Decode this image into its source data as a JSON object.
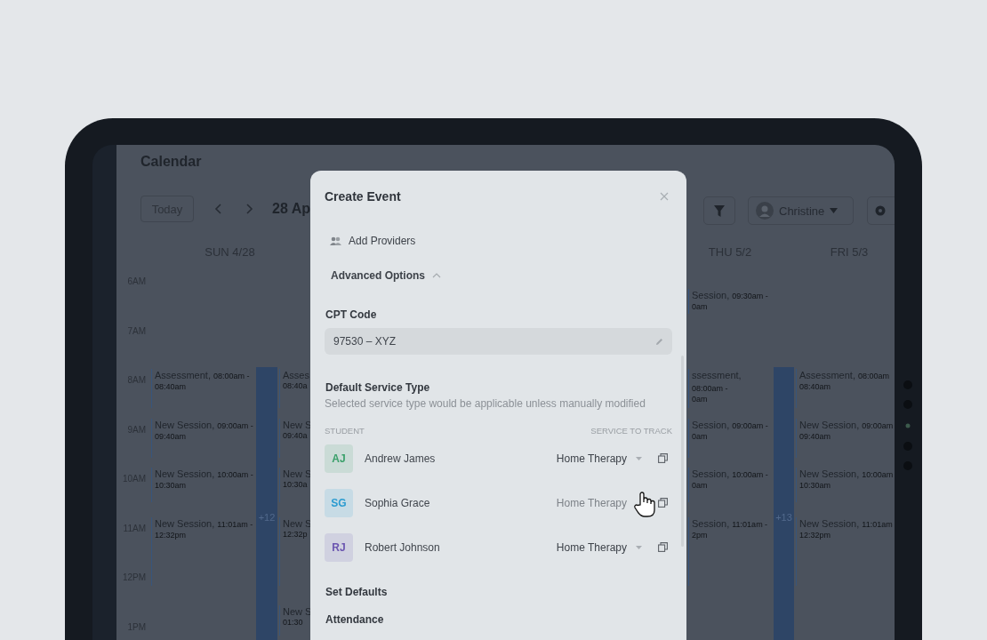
{
  "calendar": {
    "title": "Calendar",
    "today_button": "Today",
    "range_label": "28 Ap",
    "user_button": "Christine",
    "day_headers": [
      "SUN 4/28",
      "THU 5/2",
      "FRI 5/3"
    ],
    "times": [
      "6AM",
      "7AM",
      "8AM",
      "9AM",
      "10AM",
      "11AM",
      "12PM",
      "1PM"
    ],
    "columns": [
      {
        "events": [
          {
            "title": "Assessment,",
            "time": "08:00am -",
            "end": "08:40am"
          },
          {
            "title": "New Session,",
            "time": "09:00am -",
            "end": "09:40am"
          },
          {
            "title": "New Session,",
            "time": "10:00am -",
            "end": "10:30am"
          },
          {
            "title": "New Session,",
            "time": "11:01am -",
            "end": "12:32pm"
          }
        ]
      },
      {
        "more": "+12"
      },
      {
        "events": [
          {
            "title": "Asses",
            "end": "08:40a"
          },
          {
            "title": "New S",
            "end": "09:40a"
          },
          {
            "title": "New S",
            "end": "10:30a"
          },
          {
            "title": "New S",
            "end": "12:32p"
          },
          {
            "title": "New S",
            "end": "01:30"
          }
        ]
      },
      {
        "events": [
          {
            "title": "Session,",
            "time": "09:30am -",
            "end": "0am"
          },
          {
            "title": "ssessment,",
            "time": "08:00am -",
            "end": "0am"
          },
          {
            "title": "Session,",
            "time": "09:00am -",
            "end": "0am"
          },
          {
            "title": "Session,",
            "time": "10:00am -",
            "end": "0am"
          },
          {
            "title": "Session,",
            "time": "11:01am -",
            "end": "2pm"
          }
        ]
      },
      {
        "more": "+13"
      },
      {
        "events": [
          {
            "title": "Assessment,",
            "time": "08:00am",
            "end": "08:40am"
          },
          {
            "title": "New Session,",
            "time": "09:00am",
            "end": "09:40am"
          },
          {
            "title": "New Session,",
            "time": "10:00am",
            "end": "10:30am"
          },
          {
            "title": "New Session,",
            "time": "11:01am",
            "end": "12:32pm"
          }
        ]
      }
    ]
  },
  "modal": {
    "title": "Create Event",
    "add_providers": "Add Providers",
    "advanced_options": {
      "label": "Advanced Options",
      "expanded": true
    },
    "cpt_label": "CPT Code",
    "cpt_value": "97530 – XYZ",
    "service_title": "Default Service Type",
    "service_hint": "Selected service type would be applicable unless manually modified",
    "columns": [
      "STUDENT",
      "SERVICE TO TRACK"
    ],
    "students": [
      {
        "initials": "AJ",
        "name": "Andrew James",
        "color": "#3aa06a",
        "service": "Home Therapy",
        "hovered": false
      },
      {
        "initials": "SG",
        "name": "Sophia Grace",
        "color": "#2a9bd0",
        "service": "Home Therapy",
        "hovered": true
      },
      {
        "initials": "RJ",
        "name": "Robert Johnson",
        "color": "#6b55b0",
        "service": "Home Therapy",
        "hovered": false
      }
    ],
    "set_defaults": "Set Defaults",
    "attendance": "Attendance"
  }
}
